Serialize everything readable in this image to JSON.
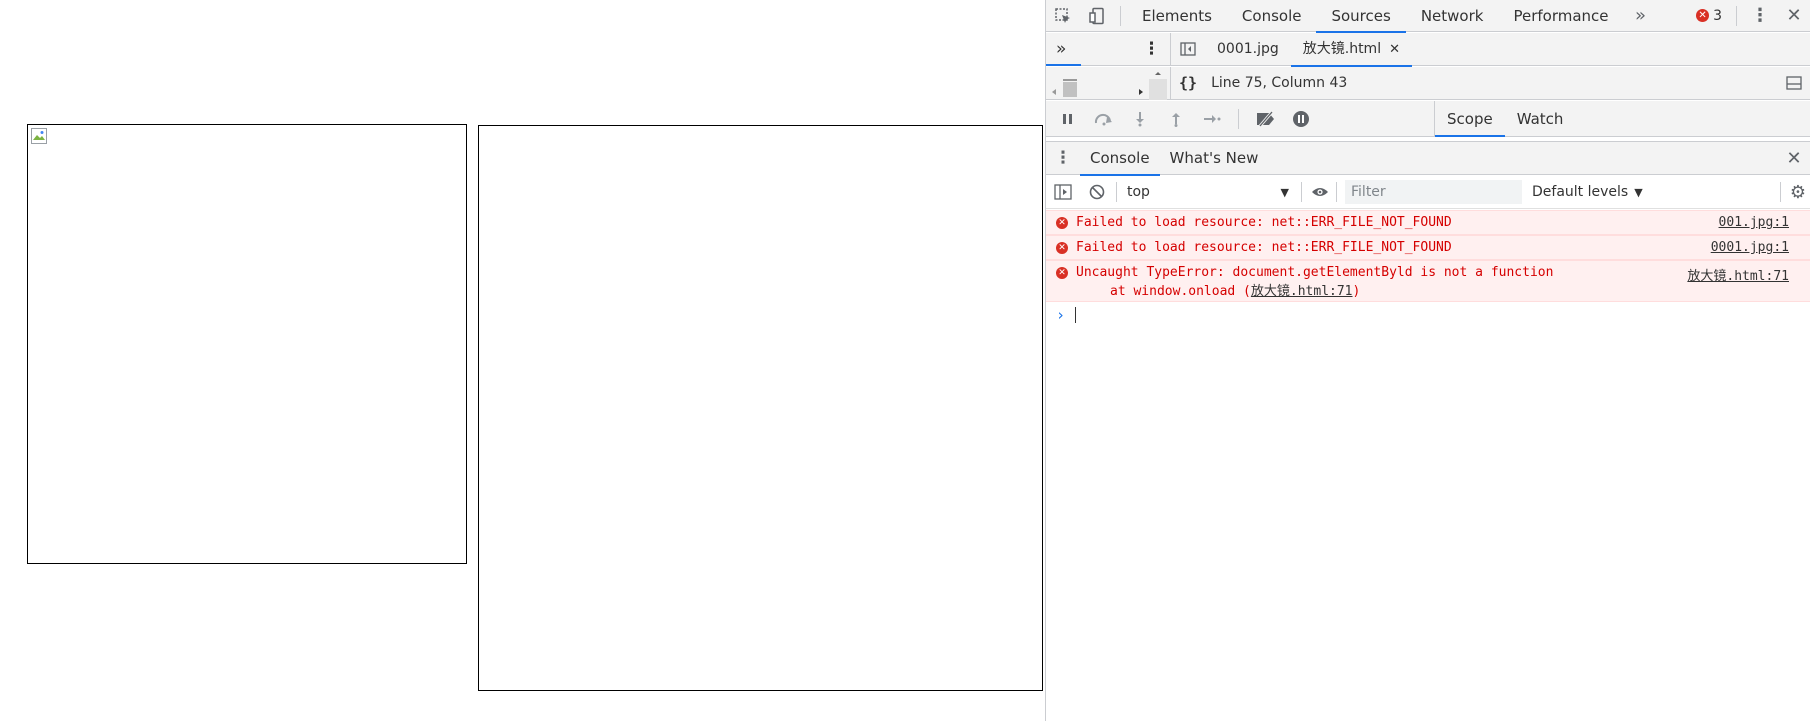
{
  "main_tabs": [
    "Elements",
    "Console",
    "Sources",
    "Network",
    "Performance"
  ],
  "active_main_tab": "Sources",
  "error_badge_count": "3",
  "file_tabs": [
    {
      "label": "0001.jpg"
    },
    {
      "label": "放大镜.html"
    }
  ],
  "status": {
    "position": "Line 75, Column 43"
  },
  "sidebar_tabs": [
    "Scope",
    "Watch"
  ],
  "drawer_tabs": [
    "Console",
    "What's New"
  ],
  "console_toolbar": {
    "context": "top",
    "filter_placeholder": "Filter",
    "levels": "Default levels"
  },
  "messages": [
    {
      "text": "Failed to load resource: net::ERR_FILE_NOT_FOUND",
      "source": "001.jpg:1"
    },
    {
      "text": "Failed to load resource: net::ERR_FILE_NOT_FOUND",
      "source": "0001.jpg:1"
    },
    {
      "text": "Uncaught TypeError: document.getElementByld is not a function",
      "source": "放大镜.html:71",
      "stack_prefix": "at window.onload (",
      "stack_link": "放大镜.html:71",
      "stack_suffix": ")"
    }
  ],
  "colors": {
    "accent": "#1a73e8",
    "error": "#d93025",
    "error_bg": "#fff0f0"
  },
  "icons": [
    "inspect-icon",
    "device-toggle-icon",
    "more-tabs-icon",
    "kebab-menu-icon",
    "close-icon",
    "sidebar-toggle-icon",
    "pretty-print-icon",
    "pause-icon",
    "step-over-icon",
    "step-into-icon",
    "step-out-icon",
    "step-icon",
    "deactivate-breakpoints-icon",
    "pause-exceptions-icon",
    "clear-console-icon",
    "eye-icon",
    "settings-icon",
    "error-icon",
    "prompt-icon"
  ]
}
